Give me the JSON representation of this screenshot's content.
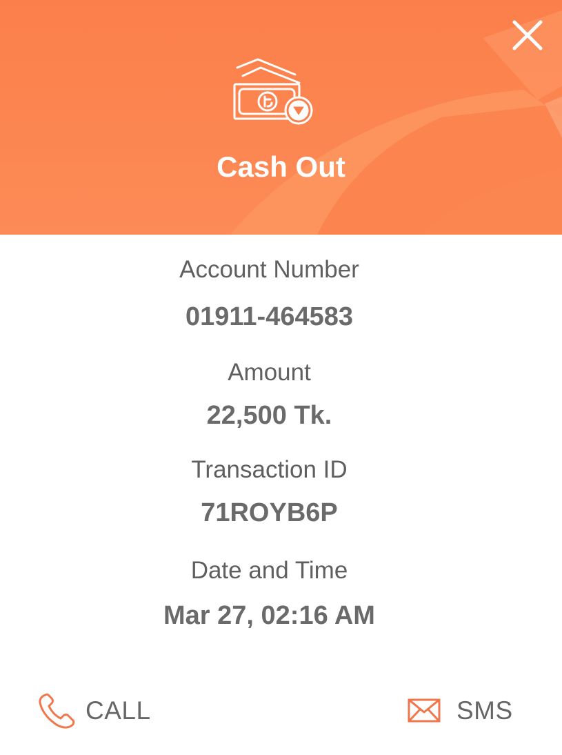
{
  "header": {
    "title": "Cash Out",
    "icon": "cash-out-money-icon",
    "close_icon": "close-icon"
  },
  "details": [
    {
      "label": "Account Number",
      "value": "01911-464583"
    },
    {
      "label": "Amount",
      "value": "22,500 Tk."
    },
    {
      "label": "Transaction ID",
      "value": "71ROYB6P"
    },
    {
      "label": "Date and Time",
      "value": "Mar 27, 02:16 AM"
    }
  ],
  "actions": {
    "call": {
      "label": "CALL",
      "icon": "phone-icon"
    },
    "sms": {
      "label": "SMS",
      "icon": "envelope-icon"
    }
  },
  "colors": {
    "accent": "#fb7f4a",
    "header_text": "#ffffff",
    "label_text": "#5f5f5f",
    "value_text": "#6a6a6a"
  }
}
